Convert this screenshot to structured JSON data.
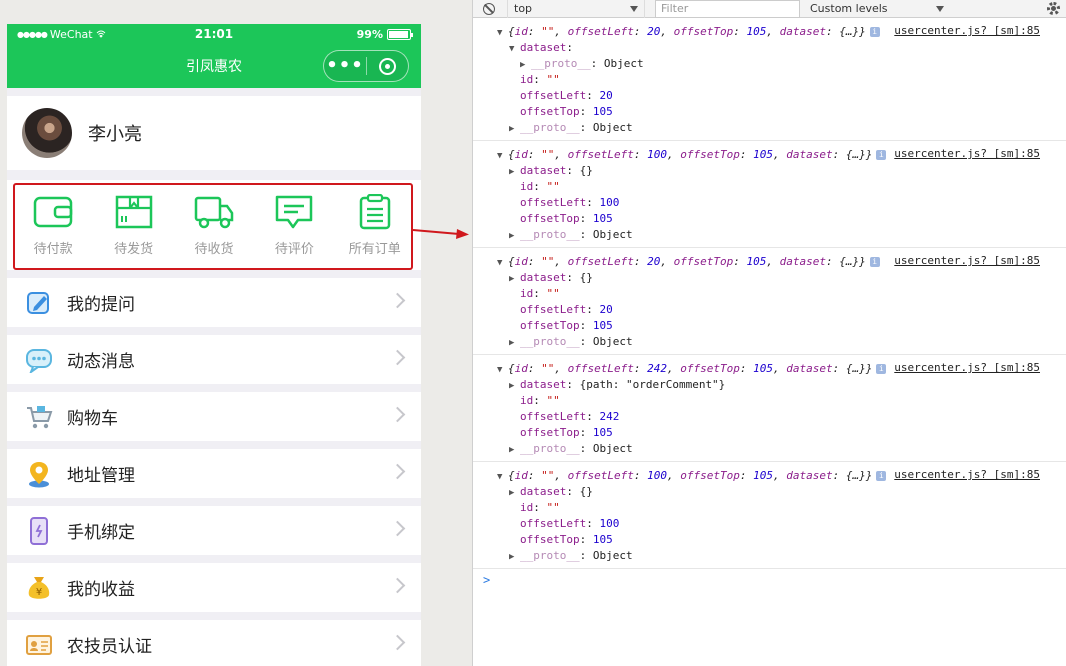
{
  "phone": {
    "status": {
      "carrier": "WeChat",
      "time": "21:01",
      "battery": "99%"
    },
    "nav": {
      "title": "引凤惠农",
      "more": "•••"
    },
    "profile": {
      "name": "李小亮"
    },
    "orders": [
      {
        "label": "待付款",
        "icon": "wallet-icon"
      },
      {
        "label": "待发货",
        "icon": "package-icon"
      },
      {
        "label": "待收货",
        "icon": "truck-icon"
      },
      {
        "label": "待评价",
        "icon": "comment-icon"
      },
      {
        "label": "所有订单",
        "icon": "order-list-icon"
      }
    ],
    "menu": [
      {
        "label": "我的提问",
        "icon": "question-icon"
      },
      {
        "label": "动态消息",
        "icon": "message-icon"
      },
      {
        "label": "购物车",
        "icon": "cart-icon"
      },
      {
        "label": "地址管理",
        "icon": "location-icon"
      },
      {
        "label": "手机绑定",
        "icon": "phone-icon"
      },
      {
        "label": "我的收益",
        "icon": "money-bag-icon"
      },
      {
        "label": "农技员认证",
        "icon": "id-card-icon"
      }
    ],
    "accent_color": "#1cc659",
    "highlight_color": "#d0181d"
  },
  "devtools": {
    "context": "top",
    "filter_placeholder": "Filter",
    "levels": "Custom levels",
    "logs": [
      {
        "source": "usercenter.js? [sm]:85",
        "summary_left": "20",
        "summary_top": "105",
        "dataset_expanded": true,
        "dataset_value": "",
        "offsetLeft": "20",
        "offsetTop": "105"
      },
      {
        "source": "usercenter.js? [sm]:85",
        "summary_left": "100",
        "summary_top": "105",
        "dataset_expanded": false,
        "dataset_value": "{}",
        "offsetLeft": "100",
        "offsetTop": "105"
      },
      {
        "source": "usercenter.js? [sm]:85",
        "summary_left": "20",
        "summary_top": "105",
        "dataset_expanded": false,
        "dataset_value": "{}",
        "offsetLeft": "20",
        "offsetTop": "105"
      },
      {
        "source": "usercenter.js? [sm]:85",
        "summary_left": "242",
        "summary_top": "105",
        "dataset_expanded": false,
        "dataset_value": "{path: \"orderComment\"}",
        "offsetLeft": "242",
        "offsetTop": "105"
      },
      {
        "source": "usercenter.js? [sm]:85",
        "summary_left": "100",
        "summary_top": "105",
        "dataset_expanded": false,
        "dataset_value": "{}",
        "offsetLeft": "100",
        "offsetTop": "105"
      }
    ],
    "text": {
      "id_key": "id",
      "empty_str": "\"\"",
      "dataset_key": "dataset",
      "proto_key": "__proto__",
      "proto_val": "Object",
      "offsetLeft_key": "offsetLeft",
      "offsetTop_key": "offsetTop",
      "dataset_ellipsis": "{…}",
      "info_badge": "i",
      "prompt": ">"
    }
  }
}
